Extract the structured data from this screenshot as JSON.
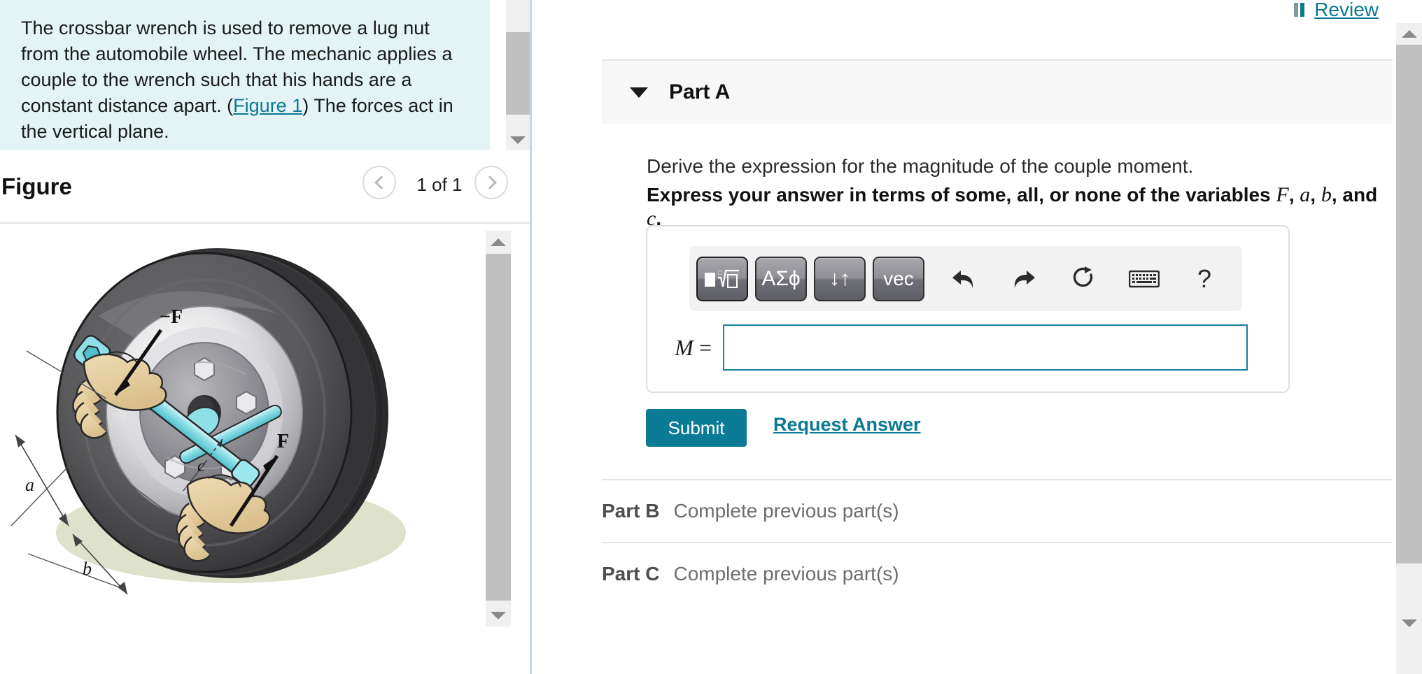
{
  "left_panel": {
    "description": {
      "prefix": "The crossbar wrench is used to remove a lug nut from the automobile wheel. The mechanic applies a couple to the wrench such that his hands are a constant distance apart. (",
      "figure_link": "Figure 1",
      "suffix": ") The forces act in the vertical plane."
    },
    "figure_header": {
      "title": "Figure",
      "counter": "1 of 1",
      "prev_icon": "chevron-left-icon",
      "next_icon": "chevron-right-icon"
    },
    "figure_image": {
      "alt": "Crossbar wrench on automobile wheel with two hands applying a couple",
      "labels": {
        "force_negative": "−F",
        "force_positive": "F",
        "dim_a": "a",
        "dim_b": "b",
        "dim_c": "c"
      }
    },
    "scrollbars": {
      "description_down_arrow": "triangle-down-icon",
      "figure_up_arrow": "triangle-up-icon",
      "figure_down_arrow": "triangle-down-icon"
    }
  },
  "right_panel": {
    "review": {
      "label": "Review",
      "icon": "review-bars-icon"
    },
    "part_a": {
      "caret_icon": "caret-down-icon",
      "title": "Part A",
      "prompt": "Derive the expression for the magnitude of the couple moment.",
      "express_prefix": "Express your answer in terms of some, all, or none of the variables ",
      "var1": "F",
      "sep1": ", ",
      "var2": "a",
      "sep2": ", ",
      "var3": "b",
      "sep3": ", and ",
      "var4": "c",
      "sep4": ".",
      "answer_label_var": "M",
      "answer_label_eq": " =",
      "answer_value": "",
      "answer_placeholder": "",
      "toolbar": [
        {
          "name": "math-template-button",
          "label": "■√□"
        },
        {
          "name": "greek-symbols-button",
          "label": "ΑΣϕ"
        },
        {
          "name": "subscript-superscript-button",
          "label": "↓↑"
        },
        {
          "name": "vector-button",
          "label": "vec"
        },
        {
          "name": "undo-icon",
          "label": "undo"
        },
        {
          "name": "redo-icon",
          "label": "redo"
        },
        {
          "name": "reset-icon",
          "label": "reset"
        },
        {
          "name": "keyboard-icon",
          "label": "keyboard"
        },
        {
          "name": "help-icon",
          "label": "?"
        }
      ],
      "submit_label": "Submit",
      "request_answer_label": "Request Answer"
    },
    "part_b": {
      "label": "Part B",
      "status": "Complete previous part(s)"
    },
    "part_c": {
      "label": "Part C",
      "status": "Complete previous part(s)"
    },
    "scrollbar": {
      "up_arrow": "triangle-up-icon",
      "down_arrow": "triangle-down-icon"
    }
  },
  "colors": {
    "accent_teal": "#0a7a94",
    "submit_teal": "#0b7b96",
    "desc_background": "#e4f3f5",
    "part_header_background": "#f7f7f7",
    "input_border": "#1b7f9e",
    "divider": "#e3e3e3",
    "column_divider": "#c5d8e2"
  }
}
